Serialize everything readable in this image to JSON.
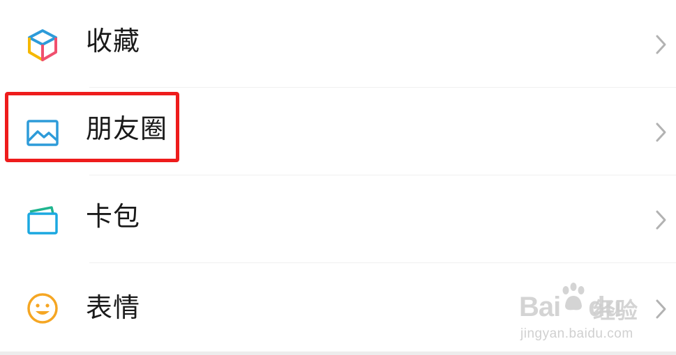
{
  "menu": {
    "items": [
      {
        "label": "收藏",
        "icon": "favorites-cube-icon"
      },
      {
        "label": "朋友圈",
        "icon": "moments-image-icon"
      },
      {
        "label": "卡包",
        "icon": "card-wallet-icon"
      },
      {
        "label": "表情",
        "icon": "smiley-face-icon"
      }
    ],
    "chevron_icon": "chevron-right-icon"
  },
  "highlight": {
    "target": "朋友圈",
    "color": "#ee1c1c"
  },
  "watermark": {
    "logo": "Bai",
    "logo_end": "du",
    "name": "经验",
    "url": "jingyan.baidu.com"
  },
  "colors": {
    "background": "#ffffff",
    "text": "#1a1a1a",
    "chevron": "#b2b2b2",
    "moments_icon": "#2d9bd9",
    "card_icon": "#1ba8e0",
    "smiley_icon": "#f5a623"
  }
}
